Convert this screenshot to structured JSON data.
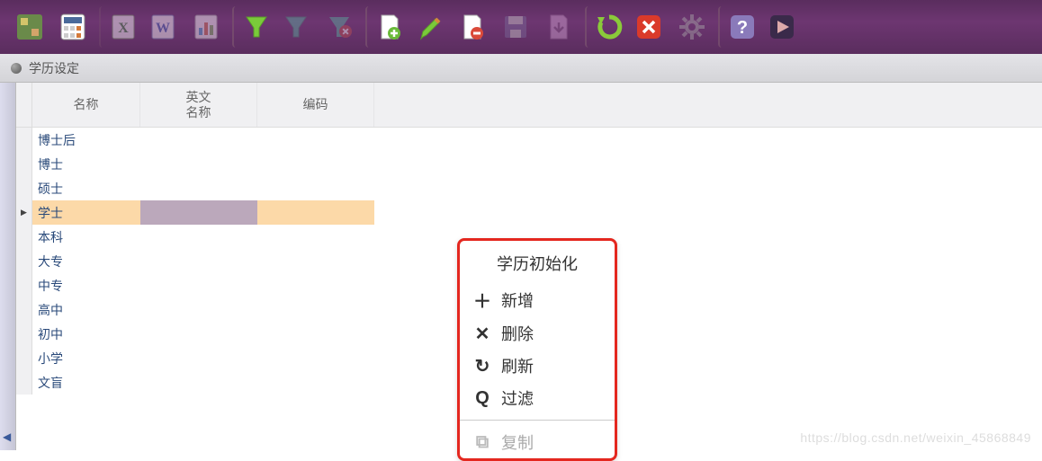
{
  "toolbar": {
    "buttons": [
      "pin-icon",
      "calc-icon",
      "excel-icon",
      "word-icon",
      "chart-icon",
      "funnel-green-icon",
      "funnel-teal-icon",
      "funnel-red-icon",
      "doc-add-icon",
      "doc-edit-icon",
      "doc-delete-icon",
      "save-icon",
      "save-to-icon",
      "refresh-icon",
      "close-icon",
      "gear-icon",
      "help-icon",
      "play-icon"
    ]
  },
  "titlebar": {
    "title": "学历设定"
  },
  "grid": {
    "columns": {
      "name": "名称",
      "eng": "英文\n名称",
      "code": "编码"
    },
    "rows": [
      {
        "name": "博士后",
        "eng": "",
        "code": "",
        "selected": false
      },
      {
        "name": "博士",
        "eng": "",
        "code": "",
        "selected": false
      },
      {
        "name": "硕士",
        "eng": "",
        "code": "",
        "selected": false
      },
      {
        "name": "学士",
        "eng": "",
        "code": "",
        "selected": true
      },
      {
        "name": "本科",
        "eng": "",
        "code": "",
        "selected": false
      },
      {
        "name": "大专",
        "eng": "",
        "code": "",
        "selected": false
      },
      {
        "name": "中专",
        "eng": "",
        "code": "",
        "selected": false
      },
      {
        "name": "高中",
        "eng": "",
        "code": "",
        "selected": false
      },
      {
        "name": "初中",
        "eng": "",
        "code": "",
        "selected": false
      },
      {
        "name": "小学",
        "eng": "",
        "code": "",
        "selected": false
      },
      {
        "name": "文盲",
        "eng": "",
        "code": "",
        "selected": false
      }
    ]
  },
  "context_menu": {
    "title": "学历初始化",
    "items": [
      {
        "icon": "plus-icon",
        "glyph": "＋",
        "label": "新增",
        "disabled": false
      },
      {
        "icon": "x-icon",
        "glyph": "✕",
        "label": "删除",
        "disabled": false
      },
      {
        "icon": "refresh-icon",
        "glyph": "↻",
        "label": "刷新",
        "disabled": false
      },
      {
        "icon": "search-icon",
        "glyph": "Q",
        "label": "过滤",
        "disabled": false
      }
    ],
    "disabled_item": {
      "icon": "copy-icon",
      "glyph": "⧉",
      "label": "复制"
    }
  },
  "watermark": "https://blog.csdn.net/weixin_45868849"
}
